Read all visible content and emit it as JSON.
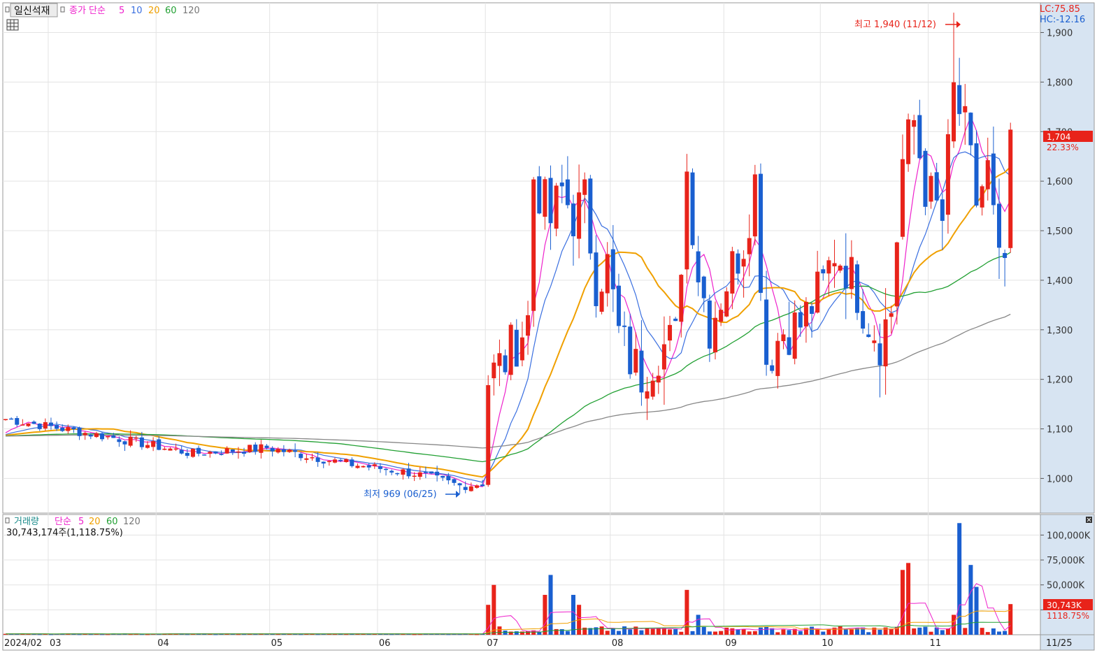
{
  "price_panel": {
    "title": "일신석재",
    "ma_label": "종가 단순",
    "periods": [
      "5",
      "10",
      "20",
      "60",
      "120"
    ],
    "lc": "LC:75.85",
    "hc": "HC:-12.16",
    "current_price_tag": "1,704",
    "current_change_tag": "22.33%",
    "high_marker": "최고 1,940 (11/12)",
    "low_marker": "최저 969 (06/25)"
  },
  "volume_panel": {
    "title": "거래량",
    "ma_label": "단순",
    "periods": [
      "5",
      "20",
      "60",
      "120"
    ],
    "summary": "30,743,174주(1,118.75%)",
    "current_volume_tag": "30,743K",
    "current_ratio_tag": "1118.75%"
  },
  "x_axis": {
    "month_labels": [
      {
        "text": "2024/02",
        "day": 0
      },
      {
        "text": "03",
        "day": 8
      },
      {
        "text": "04",
        "day": 27
      },
      {
        "text": "05",
        "day": 47
      },
      {
        "text": "06",
        "day": 66
      },
      {
        "text": "07",
        "day": 85
      },
      {
        "text": "08",
        "day": 107
      },
      {
        "text": "09",
        "day": 127
      },
      {
        "text": "10",
        "day": 144
      },
      {
        "text": "11",
        "day": 163
      }
    ],
    "end_label": "11/25"
  },
  "colors": {
    "up": "#e8231a",
    "down": "#1a5fd0",
    "ma5": "#ee22cc",
    "ma10": "#3a6fe0",
    "ma20": "#f0a000",
    "ma60": "#22a033",
    "ma120": "#888888",
    "axis_panel": "#d7e4f2",
    "grid": "#e3e3e3"
  },
  "chart_data": [
    {
      "type": "candlestick",
      "series_kind": "price",
      "ylim": [
        930,
        1960
      ],
      "y_ticks": [
        1000,
        1100,
        1200,
        1300,
        1400,
        1500,
        1600,
        1700,
        1800,
        1900
      ],
      "y_tick_labels": [
        "1,000",
        "1,100",
        "1,200",
        "1,300",
        "1,400",
        "1,500",
        "1,600",
        "1,700",
        "1,800",
        "1,900"
      ],
      "highest": {
        "value": 1940,
        "date": "11/12"
      },
      "lowest": {
        "value": 969,
        "date": "06/25"
      },
      "last_close": 1704,
      "last_change_pct": 22.33,
      "ohlc_points": [
        [
          0,
          1120
        ],
        [
          20,
          1080
        ],
        [
          33,
          1050
        ],
        [
          46,
          1062
        ],
        [
          60,
          1030
        ],
        [
          72,
          1010
        ],
        [
          80,
          985
        ],
        [
          84,
          990
        ],
        [
          85,
          1200
        ],
        [
          88,
          1240
        ],
        [
          90,
          1280
        ],
        [
          92,
          1320
        ],
        [
          93,
          1610
        ],
        [
          96,
          1520
        ],
        [
          98,
          1580
        ],
        [
          100,
          1530
        ],
        [
          102,
          1560
        ],
        [
          104,
          1400
        ],
        [
          106,
          1430
        ],
        [
          108,
          1290
        ],
        [
          110,
          1240
        ],
        [
          112,
          1210
        ],
        [
          115,
          1260
        ],
        [
          118,
          1280
        ],
        [
          120,
          1620
        ],
        [
          122,
          1420
        ],
        [
          124,
          1310
        ],
        [
          127,
          1400
        ],
        [
          130,
          1480
        ],
        [
          132,
          1600
        ],
        [
          134,
          1240
        ],
        [
          137,
          1300
        ],
        [
          140,
          1310
        ],
        [
          144,
          1390
        ],
        [
          146,
          1460
        ],
        [
          148,
          1430
        ],
        [
          150,
          1380
        ],
        [
          152,
          1320
        ],
        [
          154,
          1280
        ],
        [
          156,
          1340
        ],
        [
          158,
          1640
        ],
        [
          160,
          1720
        ],
        [
          162,
          1590
        ],
        [
          165,
          1520
        ],
        [
          167,
          1780
        ],
        [
          169,
          1700
        ],
        [
          171,
          1560
        ],
        [
          173,
          1620
        ],
        [
          175,
          1420
        ],
        [
          177,
          1460
        ]
      ],
      "moving_averages": [
        "5",
        "10",
        "20",
        "60",
        "120"
      ]
    },
    {
      "type": "bar",
      "series_kind": "volume",
      "ylim": [
        0,
        115000
      ],
      "unit": "K",
      "y_ticks": [
        25000,
        50000,
        75000,
        100000
      ],
      "y_tick_labels": [
        "",
        "50,000K",
        "75,000K",
        "100,000K"
      ],
      "last_volume": 30743,
      "spike_points": [
        [
          85,
          30000
        ],
        [
          86,
          50000
        ],
        [
          95,
          40000
        ],
        [
          96,
          60000
        ],
        [
          100,
          40000
        ],
        [
          101,
          30000
        ],
        [
          120,
          45000
        ],
        [
          122,
          20000
        ],
        [
          158,
          65000
        ],
        [
          159,
          72000
        ],
        [
          167,
          20000
        ],
        [
          168,
          112000
        ],
        [
          170,
          70000
        ],
        [
          171,
          48000
        ],
        [
          177,
          30743
        ]
      ]
    }
  ]
}
